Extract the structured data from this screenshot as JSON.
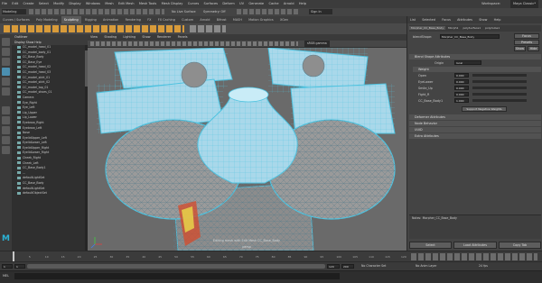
{
  "app": {
    "menus": [
      "File",
      "Edit",
      "Create",
      "Select",
      "Modify",
      "Display",
      "Windows",
      "Mesh",
      "Edit Mesh",
      "Mesh Tools",
      "Mesh Display",
      "Curves",
      "Surfaces",
      "Deform",
      "UV",
      "Generate",
      "Cache",
      "Arnold",
      "Help"
    ],
    "workspace_label": "Workspace:",
    "workspace_value": "Maya Classic*"
  },
  "status": {
    "mode": "Modeling",
    "symmetry": "Symmetry: Off",
    "live": "No Live Surface",
    "sign_in": "Sign In"
  },
  "shelf_tabs": [
    "Curves / Surfaces",
    "Poly Modeling",
    "Sculpting",
    "Rigging",
    "Animation",
    "Rendering",
    "FX",
    "FX Caching",
    "Custom",
    "Arnold",
    "Bifrost",
    "MASH",
    "Motion Graphics",
    "XGen"
  ],
  "shelf_active": "Sculpting",
  "outliner": {
    "title": "Outliner",
    "menus": [
      "Display",
      "Show",
      "Help"
    ],
    "items": [
      "CC_model_head_01",
      "CC_model_body_01",
      "CC_Base_Body",
      "CC_Base_Eye",
      "CC_model_head_02",
      "CC_model_head_03",
      "CC_model_skirt_01",
      "CC_model_skirt_02",
      "CC_model_top_01",
      "CC_model_shoes_01",
      "Camera",
      "Eye_Right",
      "Eye_Left",
      "Lip_Upper",
      "Lip_Lower",
      "Eyebrow_Right",
      "Eyebrow_Left",
      "Nose",
      "EyelidUpper_Left",
      "EyelidLower_Left",
      "EyelidUpper_Right",
      "EyelidLower_Right",
      "Cheek_Right",
      "Cheek_Left",
      "CC_Base_Body1",
      "...",
      "defaultLightSet",
      "CC_Base_Body",
      "defaultLightSet",
      "defaultObjectSet"
    ]
  },
  "viewport": {
    "menus": [
      "View",
      "Shading",
      "Lighting",
      "Show",
      "Renderer",
      "Panels"
    ],
    "colorspace": "sRGB gamma",
    "status_text": "Editing mesh with Edit Mesh CC_Base_Body",
    "camera_label": "persp"
  },
  "attribute_editor": {
    "tabs": [
      "List",
      "Selected",
      "Focus",
      "Attributes",
      "Show",
      "Help"
    ],
    "node_tabs": [
      "Morpher_CC_Base_Body",
      "Morph1",
      "polySurface1",
      "polyCube1"
    ],
    "blendshape_label": "blendShape:",
    "blendshape_value": "Morpher_CC_Base_Body",
    "focus_btn": "Focus",
    "presets_btn": "Presets",
    "show_btn": "Show",
    "hide_btn": "Hide",
    "section_main": "Blend Shape Attributes",
    "origin_label": "Origin",
    "origin_value": "local",
    "section_weight": "Weight",
    "weights": [
      {
        "label": "Open",
        "value": "0.000"
      },
      {
        "label": "EyeLower",
        "value": "0.000"
      },
      {
        "label": "Smile_Up",
        "value": "0.000"
      },
      {
        "label": "Fight_R",
        "value": "0.000"
      },
      {
        "label": "CC_Base_Body1",
        "value": "1.000"
      }
    ],
    "support_negative": "Support Negative Weights",
    "sections_collapsed": [
      "Deformer Attributes",
      "Node Behavior",
      "UUID",
      "Extra Attributes"
    ],
    "notes_label": "Notes:",
    "notes_value": "Morpher_CC_Base_Body",
    "buttons": [
      "Select",
      "Load Attributes",
      "Copy Tab"
    ]
  },
  "timeline": {
    "ticks": [
      "1",
      "5",
      "10",
      "15",
      "20",
      "25",
      "30",
      "35",
      "40",
      "45",
      "50",
      "55",
      "60",
      "65",
      "70",
      "75",
      "80",
      "85",
      "90",
      "95",
      "100",
      "105",
      "110",
      "115",
      "120"
    ],
    "current": "1"
  },
  "range": {
    "start": "1",
    "inner_start": "1",
    "inner_end": "120",
    "end": "120",
    "end2": "200",
    "character_set": "No Character Set",
    "anim_layer": "No Anim Layer",
    "fps": "24 fps"
  },
  "cmdline": {
    "lang": "MEL"
  },
  "colors": {
    "accent": "#4fc3e0",
    "mesh_fill": "#a9d8ea",
    "head_fill": "#9a9a9a",
    "highlight": "#e6d34a"
  }
}
